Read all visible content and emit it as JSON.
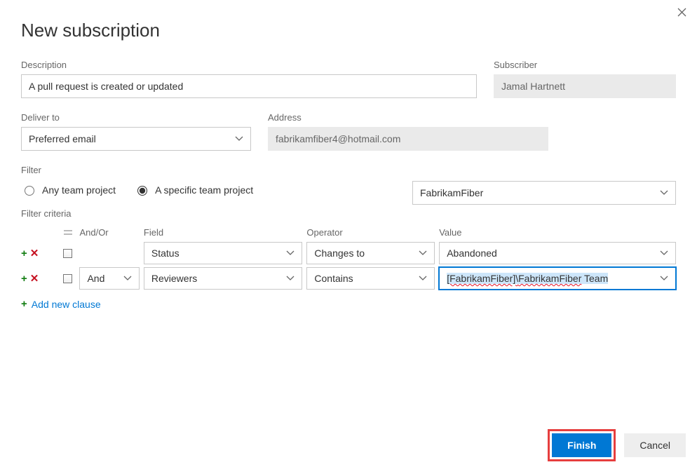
{
  "dialog": {
    "title": "New subscription"
  },
  "labels": {
    "description": "Description",
    "subscriber": "Subscriber",
    "deliver_to": "Deliver to",
    "address": "Address",
    "filter": "Filter",
    "filter_criteria": "Filter criteria",
    "andor": "And/Or",
    "field": "Field",
    "operator": "Operator",
    "value": "Value"
  },
  "fields": {
    "description": "A pull request is created or updated",
    "subscriber": "Jamal Hartnett",
    "deliver_to": "Preferred email",
    "address": "fabrikamfiber4@hotmail.com"
  },
  "filter": {
    "options": {
      "any": "Any team project",
      "specific": "A specific team project"
    },
    "selected": "specific",
    "project": "FabrikamFiber"
  },
  "criteria": {
    "rows": [
      {
        "andor": "",
        "field": "Status",
        "operator": "Changes to",
        "value": "Abandoned"
      },
      {
        "andor": "And",
        "field": "Reviewers",
        "operator": "Contains",
        "value_parts": {
          "a": "[FabrikamFiber]\\",
          "b": "FabrikamFiber",
          "c": " Team"
        }
      }
    ],
    "add_new": "Add new clause"
  },
  "buttons": {
    "finish": "Finish",
    "cancel": "Cancel"
  }
}
